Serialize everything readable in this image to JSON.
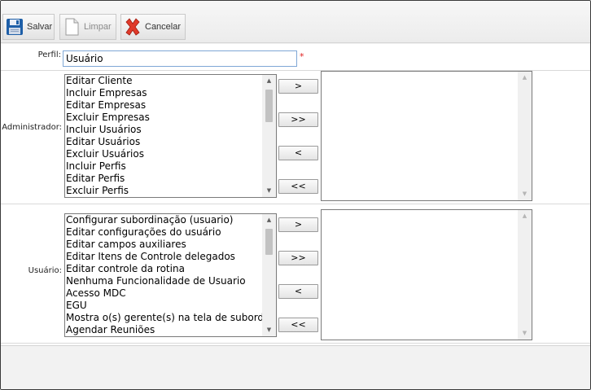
{
  "toolbar": {
    "save_label": "Salvar",
    "clear_label": "Limpar",
    "cancel_label": "Cancelar"
  },
  "form": {
    "perfil_label": "Perfil:",
    "perfil_value": "Usuário",
    "required_mark": "*"
  },
  "sections": {
    "admin": {
      "label": "Administrador:",
      "available": [
        "Editar Cliente",
        "Incluir Empresas",
        "Editar Empresas",
        "Excluir Empresas",
        "Incluir Usuários",
        "Editar Usuários",
        "Excluir Usuários",
        "Incluir Perfis",
        "Editar Perfis",
        "Excluir Perfis"
      ],
      "buttons": {
        "add_one": ">",
        "add_all": ">>",
        "remove_one": "<",
        "remove_all": "<<"
      }
    },
    "user": {
      "label": "Usuário:",
      "available": [
        "Configurar subordinação (usuario)",
        "Editar configurações do usuário",
        "Editar campos auxiliares",
        "Editar Itens de Controle delegados",
        "Editar controle da rotina",
        "Nenhuma Funcionalidade de Usuario",
        "Acesso MDC",
        "EGU",
        "Mostra o(s) gerente(s) na tela de subordinação",
        "Agendar Reuniões"
      ],
      "buttons": {
        "add_one": ">",
        "add_all": ">>",
        "remove_one": "<",
        "remove_all": "<<"
      }
    }
  },
  "colors": {
    "input_border": "#7fa7d6",
    "required": "#e02020",
    "cancel_icon": "#e03a2a",
    "save_icon": "#1e5fa8"
  },
  "icons": {
    "save": "floppy-disk-icon",
    "clear": "blank-document-icon",
    "cancel": "red-x-icon",
    "scroll_up": "triangle-up-icon",
    "scroll_down": "triangle-down-icon"
  }
}
